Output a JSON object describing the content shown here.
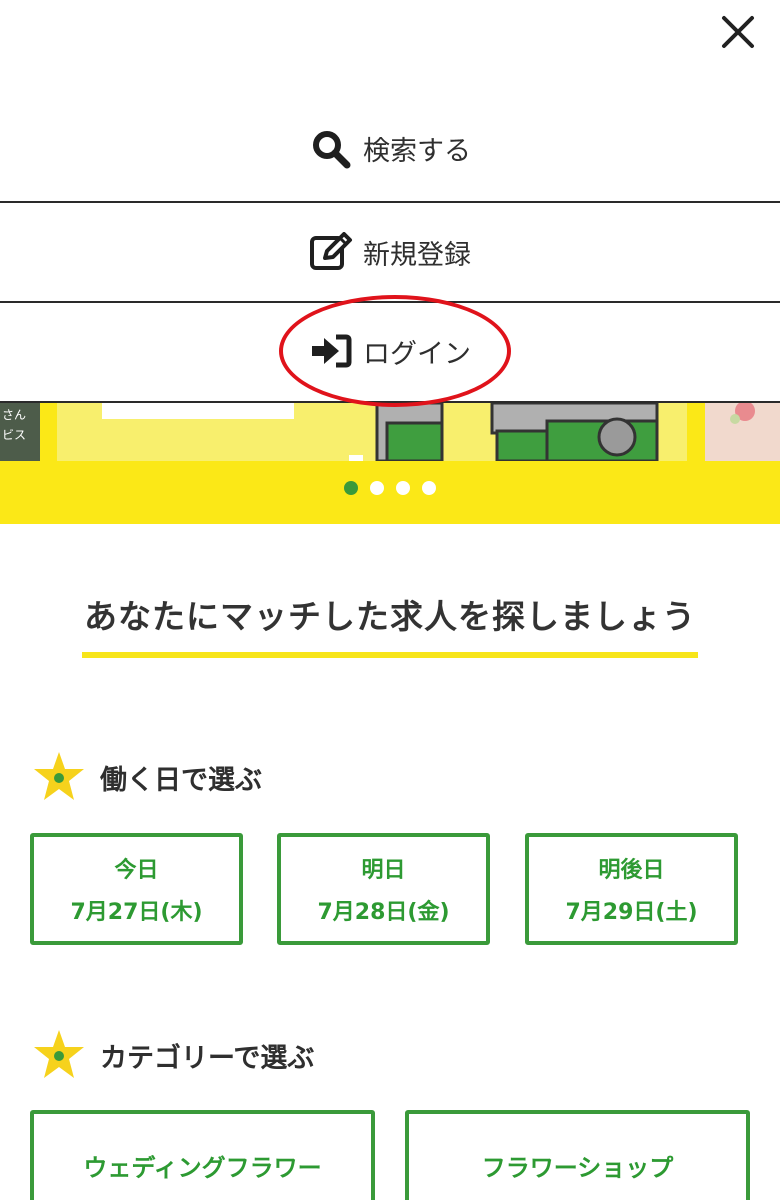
{
  "menu": {
    "search_label": "検索する",
    "register_label": "新規登録",
    "login_label": "ログイン"
  },
  "banner": {
    "left_text": [
      "さん",
      "ビス"
    ],
    "carousel": {
      "slides": 4,
      "active_index": 0
    }
  },
  "headline": "あなたにマッチした求人を探しましょう",
  "day_section": {
    "title": "働く日で選ぶ",
    "days": [
      {
        "label": "今日",
        "date": "7月27日(木)"
      },
      {
        "label": "明日",
        "date": "7月28日(金)"
      },
      {
        "label": "明後日",
        "date": "7月29日(土)"
      }
    ]
  },
  "category_section": {
    "title": "カテゴリーで選ぶ",
    "categories": [
      "ウェディングフラワー",
      "フラワーショップ"
    ]
  },
  "colors": {
    "accent_green": "#3a9a3a",
    "banner_yellow": "#fbe817",
    "highlight_red": "#e0131b"
  }
}
